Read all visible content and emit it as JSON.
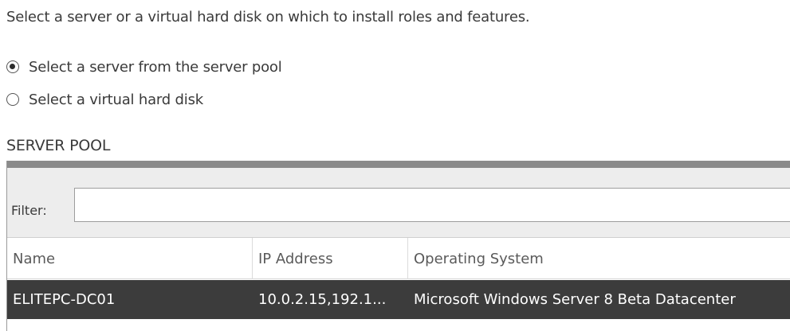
{
  "instruction": "Select a server or a virtual hard disk on which to install roles and features.",
  "install_target": {
    "options": [
      {
        "label": "Select a server from the server pool",
        "selected": true
      },
      {
        "label": "Select a virtual hard disk",
        "selected": false
      }
    ]
  },
  "server_pool": {
    "title": "SERVER POOL",
    "filter": {
      "label": "Filter:",
      "value": ""
    },
    "columns": [
      "Name",
      "IP Address",
      "Operating System"
    ],
    "rows": [
      {
        "name": "ELITEPC-DC01",
        "ip_address": "10.0.2.15,192.1...",
        "operating_system": "Microsoft Windows Server 8 Beta Datacenter",
        "selected": true
      }
    ]
  },
  "colors": {
    "selected_row": "#3c3c3c",
    "filter_bar": "#ededed"
  }
}
